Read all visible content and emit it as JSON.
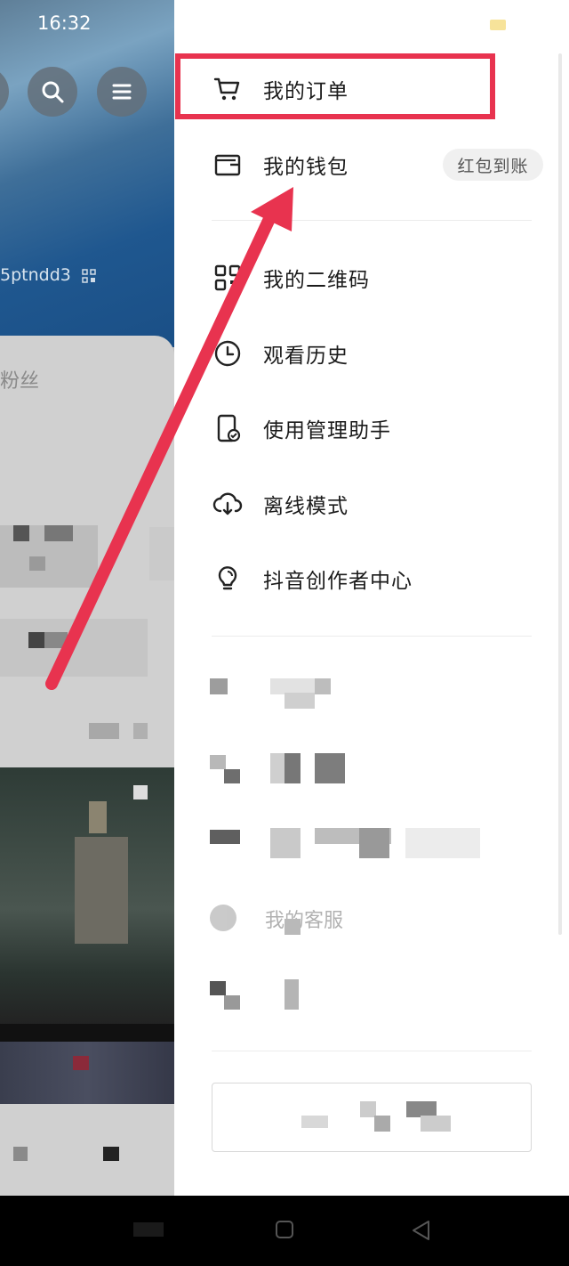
{
  "status_bar": {
    "time": "16:32"
  },
  "profile": {
    "uid_text": "5ptndd3",
    "fans_label": "粉丝"
  },
  "drawer": {
    "menu_items": [
      {
        "label": "我的订单",
        "icon": "cart-icon"
      },
      {
        "label": "我的钱包",
        "icon": "wallet-icon",
        "badge": "红包到账"
      },
      {
        "label": "我的二维码",
        "icon": "qr-code-icon"
      },
      {
        "label": "观看历史",
        "icon": "clock-icon"
      },
      {
        "label": "使用管理助手",
        "icon": "phone-check-icon"
      },
      {
        "label": "离线模式",
        "icon": "cloud-download-icon"
      },
      {
        "label": "抖音创作者中心",
        "icon": "lightbulb-icon"
      }
    ],
    "faded_items": [
      {
        "label": "我的客服",
        "icon": "headset-icon"
      }
    ]
  },
  "colors": {
    "highlight": "#e8334f",
    "badge_bg": "#f0f0f0"
  }
}
